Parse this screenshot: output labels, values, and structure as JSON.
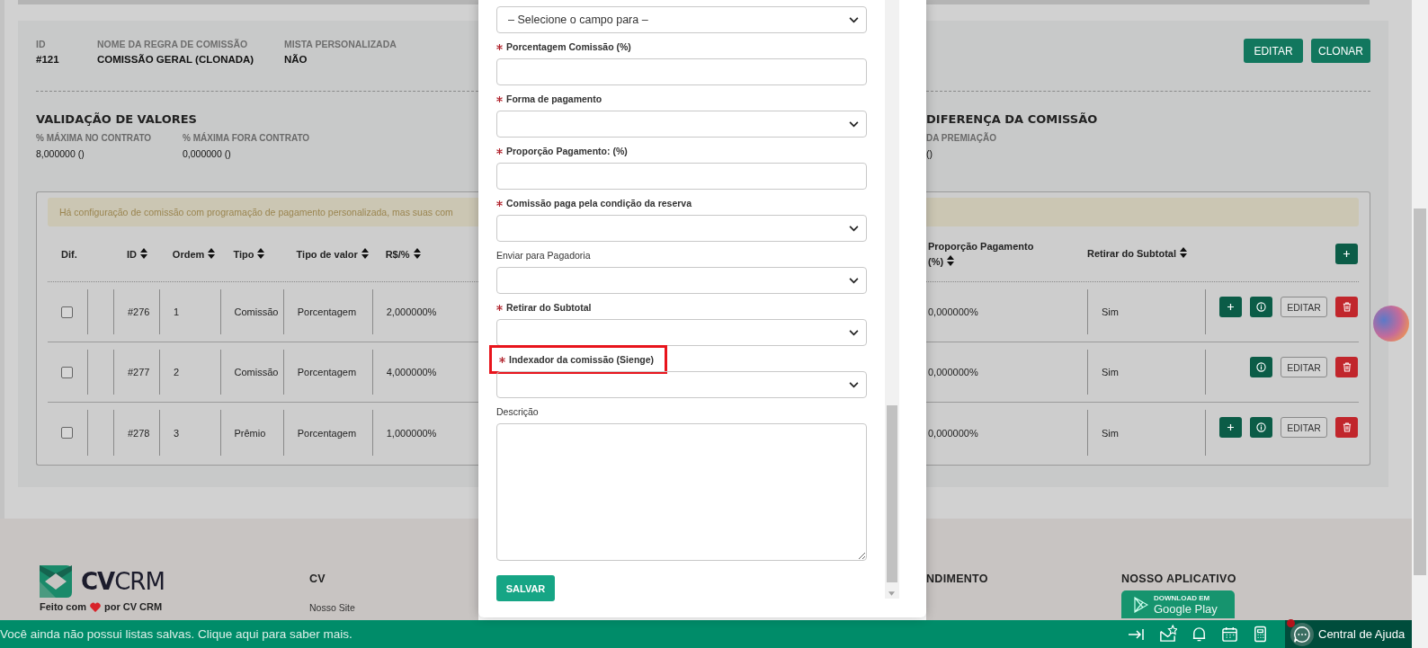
{
  "page_header": {
    "fields": [
      {
        "label": "ID",
        "value": "#121"
      },
      {
        "label": "NOME DA REGRA DE COMISSÃO",
        "value": "COMISSÃO GERAL (CLONADA)"
      },
      {
        "label": "MISTA PERSONALIZADA",
        "value": "NÃO"
      }
    ],
    "buttons": [
      "EDITAR",
      "CLONAR"
    ]
  },
  "validation": {
    "title": "VALIDAÇÃO DE VALORES",
    "fields": [
      {
        "label": "% MÁXIMA NO CONTRATO",
        "value": "8,000000 ()"
      },
      {
        "label": "% MÁXIMA FORA CONTRATO",
        "value": "0,000000 ()"
      }
    ]
  },
  "difference": {
    "title": "DIFERENÇA DA COMISSÃO",
    "fields": [
      {
        "label": "DA PREMIAÇÃO",
        "value": "()"
      }
    ]
  },
  "alert": "Há configuração de comissão com programação de pagamento personalizada, mas suas com",
  "table": {
    "columns_left": [
      {
        "label": "Dif.",
        "sortable": false
      },
      {
        "label": "ID",
        "sortable": true
      },
      {
        "label": "Ordem",
        "sortable": true
      },
      {
        "label": "Tipo",
        "sortable": true
      },
      {
        "label": "Tipo de valor",
        "sortable": true
      },
      {
        "label": "R$/%",
        "sortable": true
      }
    ],
    "columns_right": [
      {
        "label": "Proporção Pagamento (%)",
        "sortable": true
      },
      {
        "label": "Retirar do Subtotal",
        "sortable": true
      }
    ],
    "rows": [
      {
        "checked": false,
        "id": "#276",
        "ordem": "1",
        "tipo": "Comissão",
        "tipo_valor": "Porcentagem",
        "valor": "2,000000%",
        "proporcao": "0,000000%",
        "retirar": "Sim",
        "can_add": true,
        "edit_label": "EDITAR"
      },
      {
        "checked": false,
        "id": "#277",
        "ordem": "2",
        "tipo": "Comissão",
        "tipo_valor": "Porcentagem",
        "valor": "4,000000%",
        "proporcao": "0,000000%",
        "retirar": "Sim",
        "can_add": false,
        "edit_label": "EDITAR"
      },
      {
        "checked": false,
        "id": "#278",
        "ordem": "3",
        "tipo": "Prêmio",
        "tipo_valor": "Porcentagem",
        "valor": "1,000000%",
        "proporcao": "0,000000%",
        "retirar": "Sim",
        "can_add": true,
        "edit_label": "EDITAR"
      }
    ]
  },
  "modal": {
    "fields": [
      {
        "kind": "select",
        "value": "– Selecione o campo para –"
      },
      {
        "kind": "input",
        "label": "Porcentagem Comissão (%)",
        "required": true,
        "highlighted": false
      },
      {
        "kind": "select",
        "label": "Forma de pagamento",
        "required": true,
        "highlighted": false
      },
      {
        "kind": "input",
        "label": "Proporção Pagamento: (%)",
        "required": true,
        "highlighted": false
      },
      {
        "kind": "select",
        "label": "Comissão paga pela condição da reserva",
        "required": true,
        "highlighted": false
      },
      {
        "kind": "select",
        "label": "Enviar para Pagadoria",
        "required": false,
        "highlighted": false
      },
      {
        "kind": "select",
        "label": "Retirar do Subtotal",
        "required": true,
        "highlighted": false
      },
      {
        "kind": "select",
        "label": "Indexador da comissão (Sienge)",
        "required": true,
        "highlighted": true
      },
      {
        "kind": "textarea",
        "label": "Descrição",
        "required": false,
        "highlighted": false
      }
    ],
    "submit": "SALVAR"
  },
  "footer": {
    "logo": {
      "bold": "CV",
      "light": "CRM"
    },
    "made_with": [
      "Feito com",
      "por CV CRM"
    ],
    "left_column": {
      "title": "CV",
      "links": [
        "Nosso Site"
      ]
    },
    "right_columns": [
      {
        "title": "NDIMENTO"
      },
      {
        "title": "NOSSO APLICATIVO"
      }
    ],
    "store_badge": {
      "small": "DOWNLOAD EM",
      "large": "Google Play"
    }
  },
  "bottom_bar": {
    "message": "Você ainda não possui listas salvas. Clique aqui para saber mais.",
    "help": {
      "label": "Central de Ajuda",
      "notification": true
    }
  }
}
